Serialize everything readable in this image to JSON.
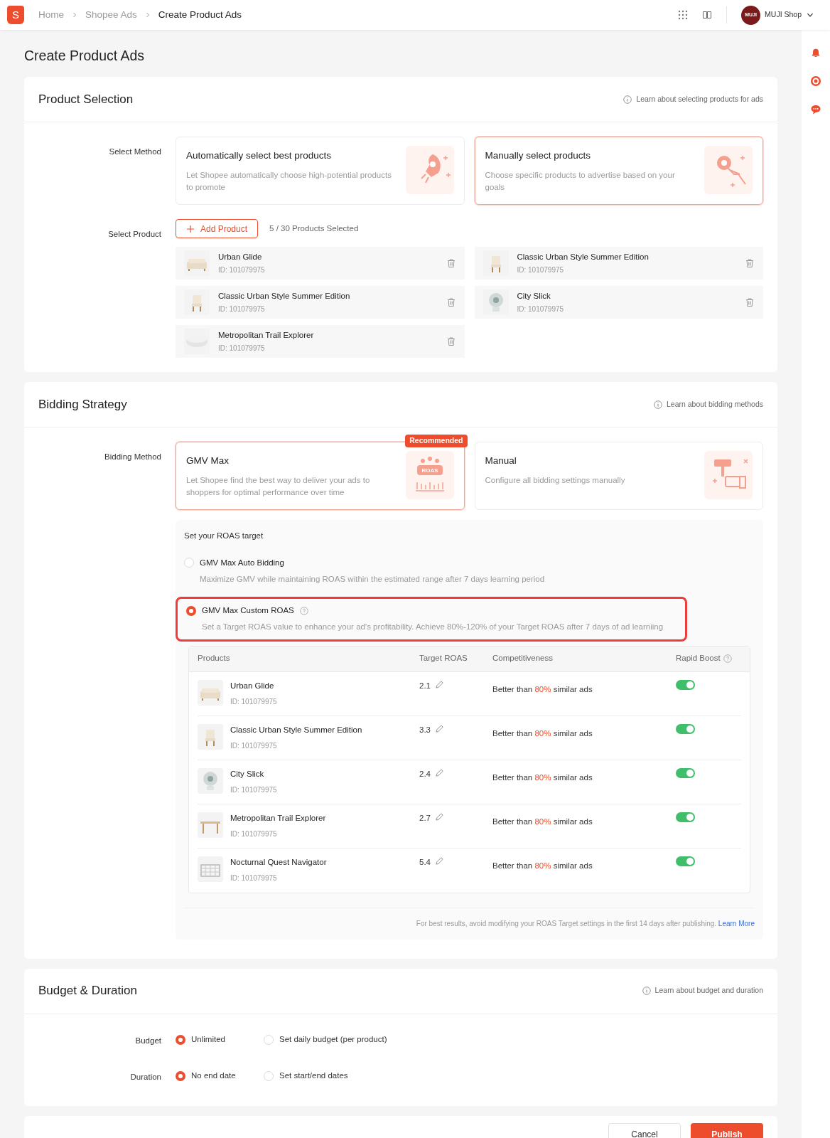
{
  "header": {
    "logo_letter": "S",
    "breadcrumbs": [
      {
        "label": "Home",
        "current": false
      },
      {
        "label": "Shopee Ads",
        "current": false
      },
      {
        "label": "Create Product Ads",
        "current": true
      }
    ],
    "shop": {
      "avatar_text": "MUJI",
      "name": "MUJI Shop"
    }
  },
  "page_title": "Create Product Ads",
  "product_selection": {
    "title": "Product Selection",
    "help": "Learn about selecting products for ads",
    "method_label": "Select Method",
    "methods": [
      {
        "title": "Automatically select best products",
        "description": "Let Shopee automatically choose high-potential products to promote",
        "selected": false
      },
      {
        "title": "Manually select products",
        "description": "Choose specific products to advertise based on your goals",
        "selected": true
      }
    ],
    "product_label": "Select Product",
    "add_button": "Add Product",
    "count": "5 / 30 Products Selected",
    "products": [
      {
        "name": "Urban Glide",
        "id": "ID: 101079975"
      },
      {
        "name": "Classic Urban Style Summer Edition",
        "id": "ID: 101079975"
      },
      {
        "name": "Classic Urban Style Summer Edition",
        "id": "ID: 101079975"
      },
      {
        "name": "City Slick",
        "id": "ID: 101079975"
      },
      {
        "name": "Metropolitan Trail Explorer",
        "id": "ID: 101079975"
      }
    ]
  },
  "bidding": {
    "title": "Bidding Strategy",
    "help": "Learn about bidding methods",
    "method_label": "Bidding Method",
    "methods": [
      {
        "title": "GMV Max",
        "description": "Let Shopee find the best way to deliver your ads to shoppers for optimal performance over time",
        "selected": true,
        "badge": "Recommended",
        "illustration_text": "ROAS"
      },
      {
        "title": "Manual",
        "description": "Configure all bidding settings manually",
        "selected": false
      }
    ],
    "roas": {
      "title": "Set your ROAS target",
      "options": [
        {
          "label": "GMV Max Auto Bidding",
          "description": "Maximize GMV while maintaining ROAS within the estimated range after 7 days learning period",
          "selected": false,
          "help": false
        },
        {
          "label": "GMV Max Custom ROAS",
          "description": "Set a Target ROAS value to enhance your ad's profitability. Achieve 80%-120% of your Target ROAS after 7 days of ad learniing",
          "selected": true,
          "help": true
        }
      ],
      "table": {
        "columns": [
          {
            "label": "Products",
            "help": false
          },
          {
            "label": "Target ROAS",
            "help": false
          },
          {
            "label": "Competitiveness",
            "help": false
          },
          {
            "label": "Rapid Boost",
            "help": true
          }
        ],
        "rows": [
          {
            "name": "Urban Glide",
            "id": "ID: 101079975",
            "target": "2.1",
            "comp_prefix": "Better than",
            "comp_percent": "80%",
            "comp_suffix": "similar ads",
            "on": true
          },
          {
            "name": "Classic Urban Style Summer Edition",
            "id": "ID: 101079975",
            "target": "3.3",
            "comp_prefix": "Better than",
            "comp_percent": "80%",
            "comp_suffix": "similar ads",
            "on": true
          },
          {
            "name": "City Slick",
            "id": "ID: 101079975",
            "target": "2.4",
            "comp_prefix": "Better than",
            "comp_percent": "80%",
            "comp_suffix": "similar ads",
            "on": true
          },
          {
            "name": "Metropolitan Trail Explorer",
            "id": "ID: 101079975",
            "target": "2.7",
            "comp_prefix": "Better than",
            "comp_percent": "80%",
            "comp_suffix": "similar ads",
            "on": true
          },
          {
            "name": "Nocturnal Quest Navigator",
            "id": "ID: 101079975",
            "target": "5.4",
            "comp_prefix": "Better than",
            "comp_percent": "80%",
            "comp_suffix": "similar ads",
            "on": true
          }
        ]
      },
      "note": "For best results, avoid modifying your ROAS Target settings in the first 14 days after publishing.",
      "note_link": "Learn More"
    }
  },
  "budget": {
    "title": "Budget & Duration",
    "help": "Learn about budget and duration",
    "rows": [
      {
        "label": "Budget",
        "options": [
          {
            "label": "Unlimited",
            "selected": true
          },
          {
            "label": "Set daily budget (per product)",
            "selected": false
          }
        ]
      },
      {
        "label": "Duration",
        "options": [
          {
            "label": "No end date",
            "selected": true
          },
          {
            "label": "Set start/end dates",
            "selected": false
          }
        ]
      }
    ]
  },
  "actions": [
    {
      "label": "Cancel",
      "kind": "secondary"
    },
    {
      "label": "Publish",
      "kind": "primary"
    }
  ]
}
